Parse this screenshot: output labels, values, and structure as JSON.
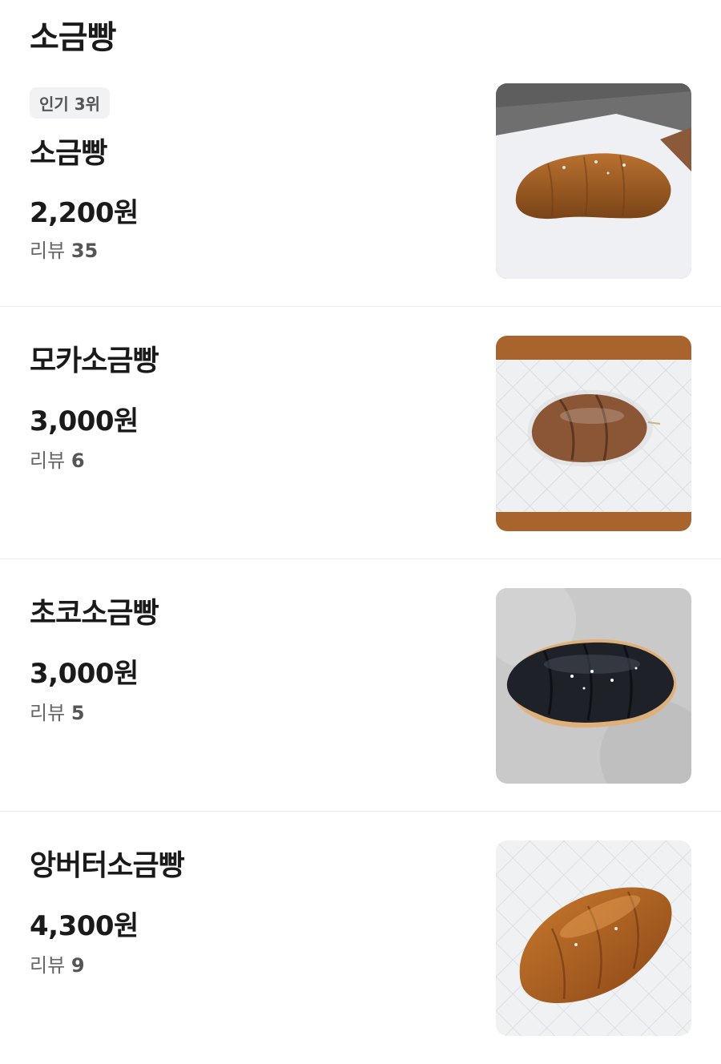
{
  "section": {
    "title": "소금빵"
  },
  "items": [
    {
      "badge": "인기 3위",
      "name": "소금빵",
      "price": "2,200원",
      "review_label": "리뷰",
      "review_count": "35",
      "image": "salt-bread-photo"
    },
    {
      "name": "모카소금빵",
      "price": "3,000원",
      "review_label": "리뷰",
      "review_count": "6",
      "image": "mocha-salt-bread-photo"
    },
    {
      "name": "초코소금빵",
      "price": "3,000원",
      "review_label": "리뷰",
      "review_count": "5",
      "image": "choco-salt-bread-photo"
    },
    {
      "name": "앙버터소금빵",
      "price": "4,300원",
      "review_label": "리뷰",
      "review_count": "9",
      "image": "anbutter-salt-bread-photo"
    }
  ]
}
